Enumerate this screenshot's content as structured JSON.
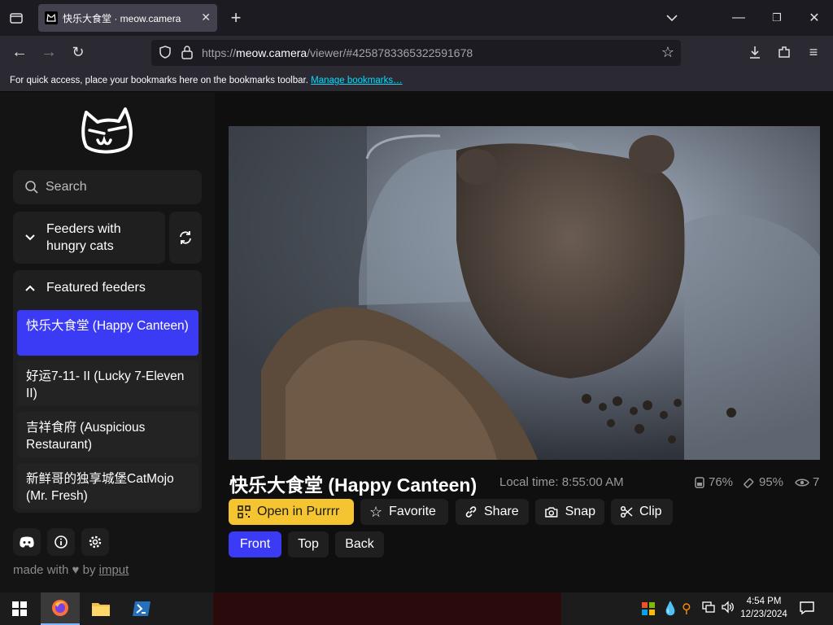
{
  "browser": {
    "tab_title": "快乐大食堂 · meow.camera",
    "url_prefix": "https://",
    "url_host": "meow.camera",
    "url_path": "/viewer/#4258783365322591678",
    "bookmarks_text": "For quick access, place your bookmarks here on the bookmarks toolbar.",
    "bookmarks_link": "Manage bookmarks…"
  },
  "sidebar": {
    "search_placeholder": "Search",
    "hungry_label": "Feeders with hungry cats",
    "featured_label": "Featured feeders",
    "feeders": [
      {
        "label": "快乐大食堂 (Happy Canteen)",
        "active": true
      },
      {
        "label": "好运7-11- II  (Lucky 7-Eleven II)",
        "active": false
      },
      {
        "label": "吉祥食府 (Auspicious Restaurant)",
        "active": false
      },
      {
        "label": "新鲜哥的独享城堡CatMojo (Mr. Fresh)",
        "active": false
      }
    ],
    "made_with": "made with",
    "by": "by",
    "author": "imput"
  },
  "viewer": {
    "title": "快乐大食堂 (Happy Canteen)",
    "local_time": "Local time: 8:55:00 AM",
    "food_level": "76%",
    "battery_level": "95%",
    "viewers": "7",
    "buttons": {
      "open_purrrr": "Open in Purrrr",
      "favorite": "Favorite",
      "share": "Share",
      "snap": "Snap",
      "clip": "Clip"
    },
    "views": [
      "Front",
      "Top",
      "Back"
    ],
    "active_view": "Front"
  },
  "taskbar": {
    "time": "4:54 PM",
    "date": "12/23/2024"
  },
  "colors": {
    "accent": "#3b3bf5",
    "purrrr_yellow": "#f5c431",
    "link_cyan": "#00ddff"
  },
  "icons": [
    "tab-list-icon",
    "back-icon",
    "forward-icon",
    "reload-icon",
    "shield-icon",
    "lock-icon",
    "star-icon",
    "download-icon",
    "extensions-icon",
    "menu-icon",
    "cat-logo-icon",
    "search-icon",
    "chevron-down-icon",
    "refresh-icon",
    "chevron-up-icon",
    "discord-icon",
    "info-icon",
    "gear-icon",
    "heart-icon",
    "qr-icon",
    "share-icon",
    "camera-icon",
    "scissors-icon",
    "eye-icon",
    "windows-start-icon"
  ]
}
